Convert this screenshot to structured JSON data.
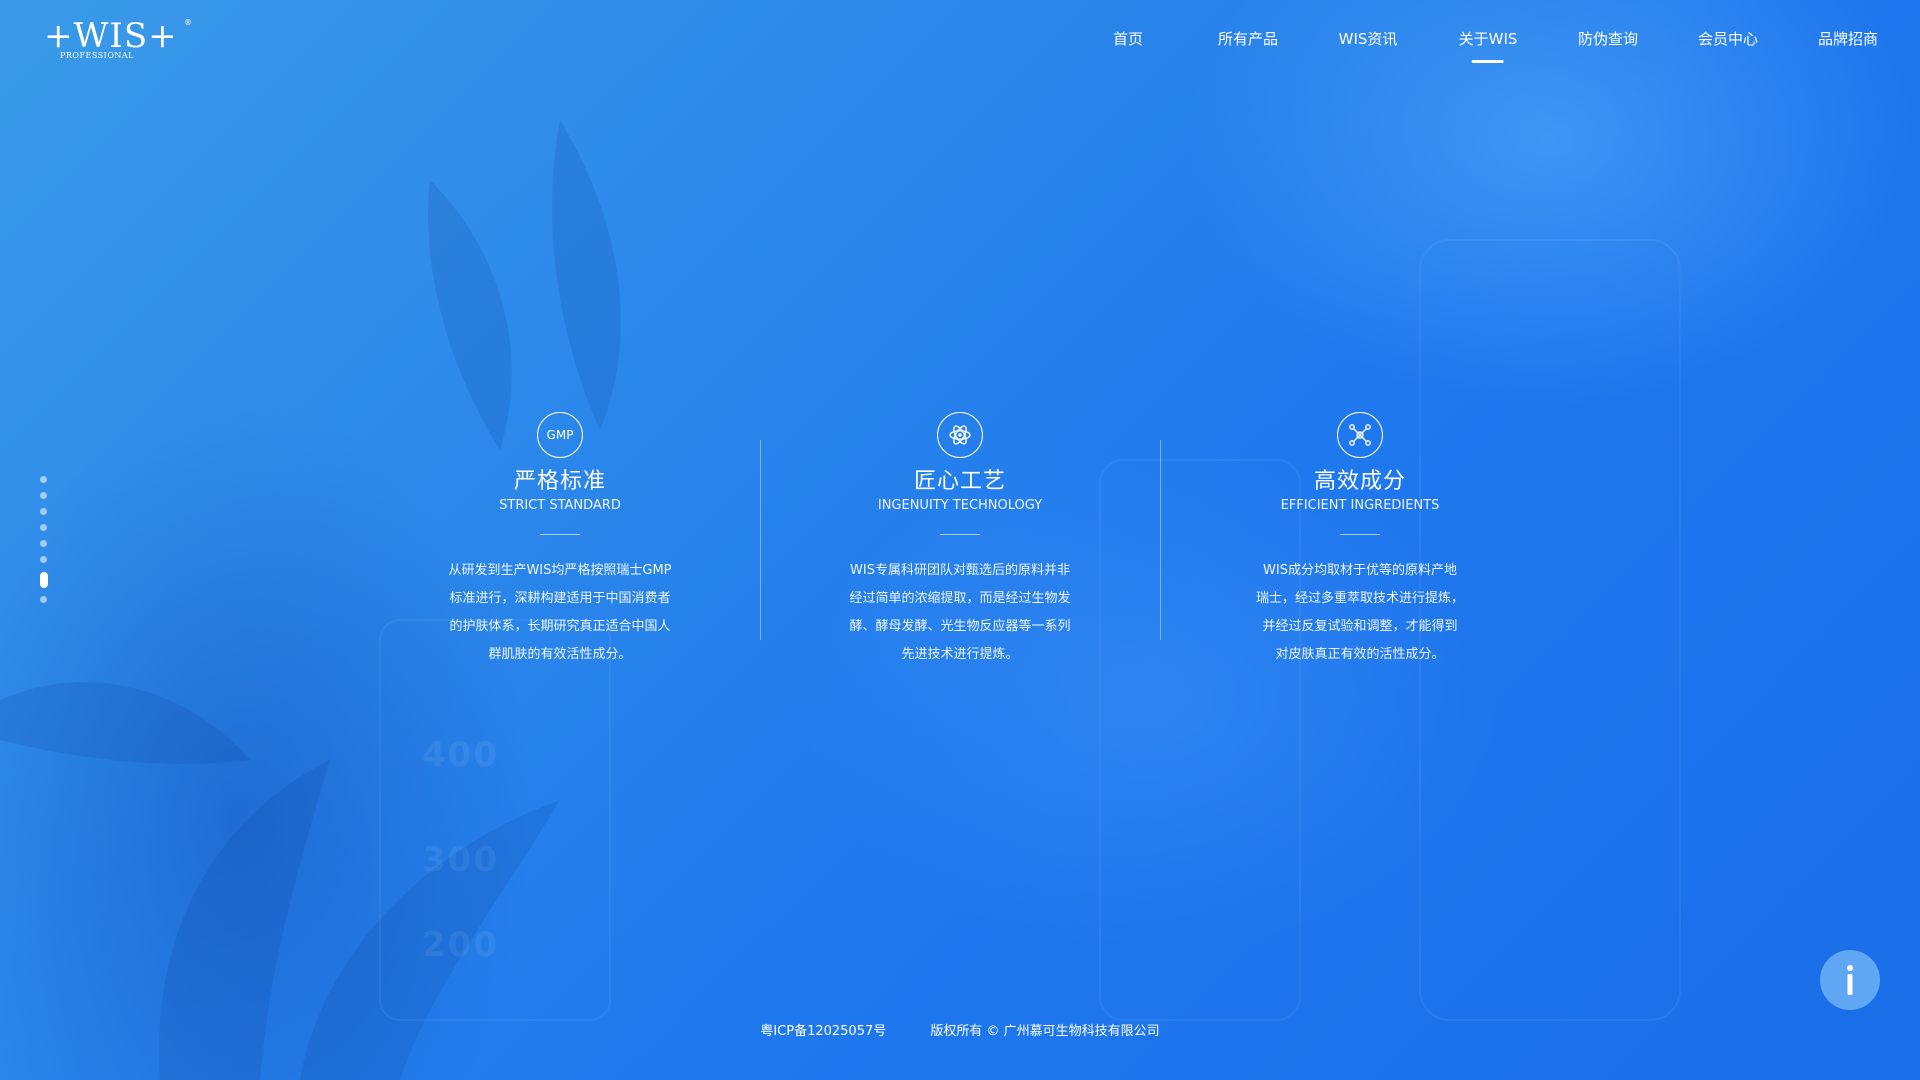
{
  "logo": {
    "main": "+WIS+",
    "sub": "PROFESSIONAL",
    "reg": "®"
  },
  "nav": {
    "items": [
      {
        "label": "首页",
        "active": false
      },
      {
        "label": "所有产品",
        "active": false
      },
      {
        "label": "WIS资讯",
        "active": false
      },
      {
        "label": "关于WIS",
        "active": true
      },
      {
        "label": "防伪查询",
        "active": false
      },
      {
        "label": "会员中心",
        "active": false
      },
      {
        "label": "品牌招商",
        "active": false
      }
    ]
  },
  "pager": {
    "count": 8,
    "active_index": 6
  },
  "features": [
    {
      "icon": "gmp-icon",
      "icon_text": "GMP",
      "title": "严格标准",
      "subtitle": "STRICT STANDARD",
      "text_lines": [
        "从研发到生产WIS均严格按照瑞士GMP",
        "标准进行，深耕构建适用于中国消费者",
        "的护肤体系，长期研究真正适合中国人",
        "群肌肤的有效活性成分。"
      ]
    },
    {
      "icon": "atom-icon",
      "title": "匠心工艺",
      "subtitle": "INGENUITY TECHNOLOGY",
      "text_lines": [
        "WIS专属科研团队对甄选后的原料并非",
        "经过简单的浓缩提取，而是经过生物发",
        "酵、酵母发酵、光生物反应器等一系列",
        "先进技术进行提炼。"
      ]
    },
    {
      "icon": "molecule-icon",
      "title": "高效成分",
      "subtitle": "EFFICIENT INGREDIENTS",
      "text_lines": [
        "WIS成分均取材于优等的原料产地",
        "瑞士，经过多重萃取技术进行提炼，",
        "并经过反复试验和调整，才能得到",
        "对皮肤真正有效的活性成分。"
      ]
    }
  ],
  "footer": {
    "icp": "粤ICP备12025057号",
    "copyright": "版权所有 © 广州慕可生物科技有限公司"
  },
  "info_button": {
    "icon": "info-icon",
    "glyph": "i"
  },
  "colors": {
    "bg_start": "#3a9ae8",
    "bg_end": "#1a6ee8",
    "text": "#ffffff"
  }
}
